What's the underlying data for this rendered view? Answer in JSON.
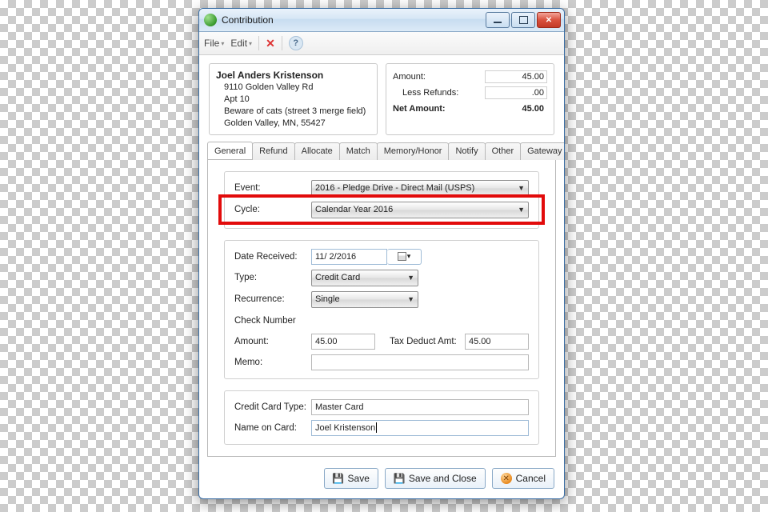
{
  "window": {
    "title": "Contribution"
  },
  "toolbar": {
    "file": "File",
    "edit": "Edit"
  },
  "contact": {
    "name": "Joel Anders Kristenson",
    "line1": "9110 Golden Valley Rd",
    "line2": "Apt 10",
    "line3": "Beware of cats (street 3 merge field)",
    "line4": "Golden Valley, MN, 55427"
  },
  "summary": {
    "amount_label": "Amount:",
    "amount": "45.00",
    "less_refunds_label": "Less Refunds:",
    "less_refunds": ".00",
    "net_label": "Net Amount:",
    "net": "45.00"
  },
  "tabs": {
    "general": "General",
    "refund": "Refund",
    "allocate": "Allocate",
    "match": "Match",
    "memory": "Memory/Honor",
    "notify": "Notify",
    "other": "Other",
    "gateway": "Gateway"
  },
  "general": {
    "event_label": "Event:",
    "event_value": "2016 - Pledge Drive - Direct Mail (USPS)",
    "cycle_label": "Cycle:",
    "cycle_value": "Calendar Year 2016",
    "date_received_label": "Date Received:",
    "date_received_value": "11/  2/2016",
    "type_label": "Type:",
    "type_value": "Credit Card",
    "recurrence_label": "Recurrence:",
    "recurrence_value": "Single",
    "check_number_label": "Check Number",
    "amount_label": "Amount:",
    "amount_value": "45.00",
    "tax_deduct_label": "Tax Deduct Amt:",
    "tax_deduct_value": "45.00",
    "memo_label": "Memo:",
    "cc_type_label": "Credit Card Type:",
    "cc_type_value": "Master Card",
    "name_on_card_label": "Name on Card:",
    "name_on_card_value": "Joel Kristenson"
  },
  "buttons": {
    "save": "Save",
    "save_close": "Save and Close",
    "cancel": "Cancel"
  }
}
